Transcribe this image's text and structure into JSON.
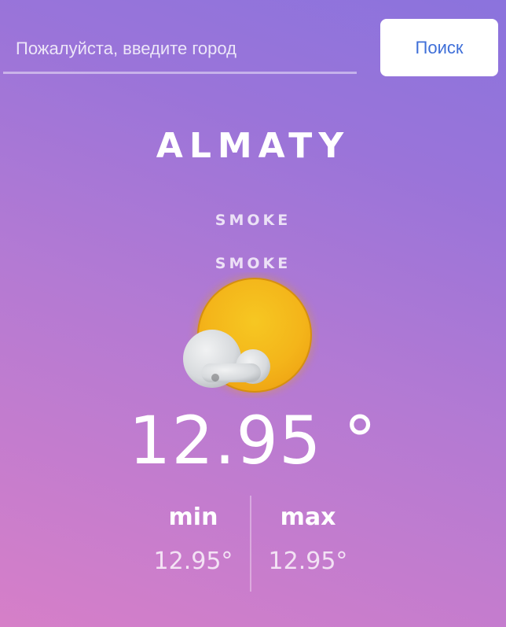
{
  "search": {
    "placeholder": "Пожалуйста, введите город",
    "button_label": "Поиск"
  },
  "weather": {
    "city": "ALMATY",
    "description": "SMOKE",
    "description_secondary": "SMOKE",
    "icon": "sun-behind-cloud-icon",
    "temperature": "12.95 °",
    "min_label": "min",
    "min_value": "12.95°",
    "max_label": "max",
    "max_value": "12.95°"
  },
  "colors": {
    "background_start": "#d67fc8",
    "background_end": "#8b73dd",
    "button_text": "#3f6fd8",
    "sun": "#f5b81c",
    "cloud": "#d9dcdf"
  }
}
